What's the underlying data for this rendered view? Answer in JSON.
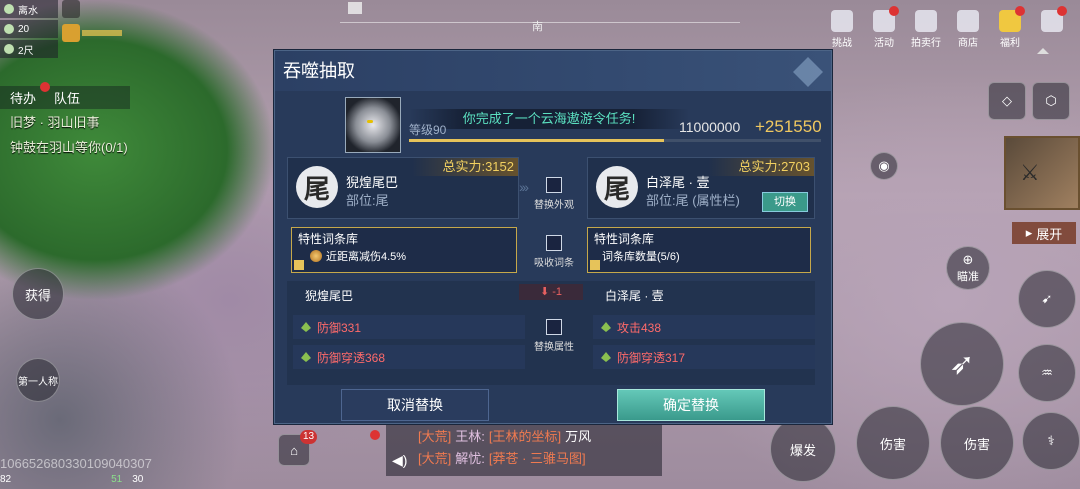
{
  "hud": {
    "stats": [
      {
        "icon": "water-drop-icon",
        "value": "离水"
      },
      {
        "icon": "moon-icon",
        "value": "20"
      },
      {
        "icon": "depth-icon",
        "value": "2尺"
      }
    ],
    "compass_label": "南",
    "quest_tabs": [
      "待办",
      "队伍"
    ],
    "quest_lines": [
      "旧梦 · 羽山旧事",
      "钟鼓在羽山等你(0/1)"
    ],
    "left_buttons": [
      "获得",
      "第一人称"
    ],
    "top_menu": [
      "挑战",
      "活动",
      "拍卖行",
      "商店",
      "福利"
    ],
    "right_labels": {
      "expand": "展开",
      "aim": "瞄准"
    },
    "skills": [
      "爆发",
      "伤害",
      "伤害"
    ],
    "player_id": "10665268033010904030​7",
    "bottom_status": [
      "82",
      "51",
      "30"
    ],
    "notification_count": "13"
  },
  "modal": {
    "title": "吞噬抽取",
    "level": "等级90",
    "banner": "你完成了一个云海遨游令任务!",
    "exp_value": "11000000",
    "exp_gain": "+251550",
    "exp_progress": 0.62,
    "left_slot": {
      "glyph": "尾",
      "name": "猊煌尾巴",
      "position": "部位:尾",
      "power": "总实力:3152"
    },
    "right_slot": {
      "glyph": "尾",
      "name": "白泽尾 · 壹",
      "position": "部位:尾 (属性栏)",
      "power": "总实力:2703",
      "switch_label": "切换"
    },
    "appearance_toggle": "替换外观",
    "left_trait": {
      "title": "特性词条库",
      "value": "近距离减伤4.5%"
    },
    "right_trait": {
      "title": "特性词条库",
      "value": "词条库数量(5/6)"
    },
    "trait_toggle": "吸收词条",
    "attr_toggle": "替换属性",
    "diff": "-1",
    "left_stats": {
      "header": "猊煌尾巴",
      "rows": [
        "防御331",
        "防御穿透368"
      ]
    },
    "right_stats": {
      "header": "白泽尾 · 壹",
      "rows": [
        "攻击438",
        "防御穿透317"
      ]
    },
    "cancel_label": "取消替换",
    "confirm_label": "确定替换"
  },
  "chat": [
    {
      "channel": "[大荒]",
      "user": "王林:",
      "link": "[王林的坐标]",
      "text": "万风"
    },
    {
      "channel": "[大荒]",
      "user": "解忧:",
      "link": "[莽苍 · 三骓马图]",
      "text": ""
    }
  ],
  "colors": {
    "panel": "#283a5a",
    "accent_gold": "#f0c860",
    "accent_teal": "#5be0c0",
    "defense_red": "#ff6a6a",
    "attack_red": "#ff6a6a"
  }
}
